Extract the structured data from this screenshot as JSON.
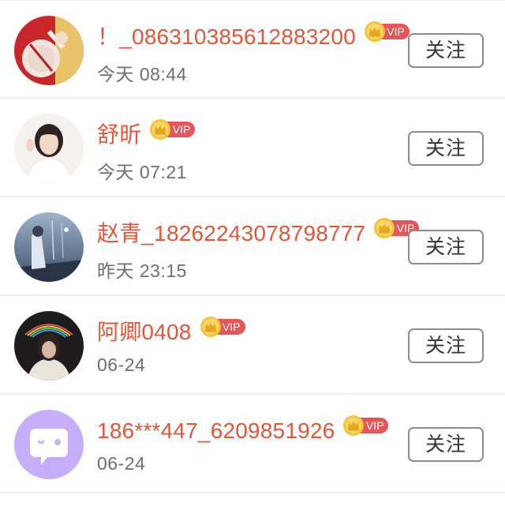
{
  "follow_list": {
    "items": [
      {
        "name": "！_086310385612883200",
        "vip_label": "VIP",
        "time": "今天 08:44",
        "follow_label": "关注",
        "avatar": "avatar-red-photo"
      },
      {
        "name": "舒昕",
        "vip_label": "VIP",
        "time": "今天 07:21",
        "follow_label": "关注",
        "avatar": "avatar-woman-white-photo"
      },
      {
        "name": "赵青_18262243078798777",
        "vip_label": "VIP",
        "time": "昨天 23:15",
        "follow_label": "关注",
        "avatar": "avatar-anime-blue-photo"
      },
      {
        "name": "阿卿0408",
        "vip_label": "VIP",
        "time": "06-24",
        "follow_label": "关注",
        "avatar": "avatar-dark-rainbow-photo"
      },
      {
        "name": "186***447_6209851926",
        "vip_label": "VIP",
        "time": "06-24",
        "follow_label": "关注",
        "avatar": "avatar-default-chat-icon"
      }
    ]
  },
  "colors": {
    "name": "#e0573a",
    "time": "#6e6e6e",
    "vip_badge": "#e4565a",
    "crown": "#f3c43b",
    "default_avatar": "#c7aefb"
  }
}
